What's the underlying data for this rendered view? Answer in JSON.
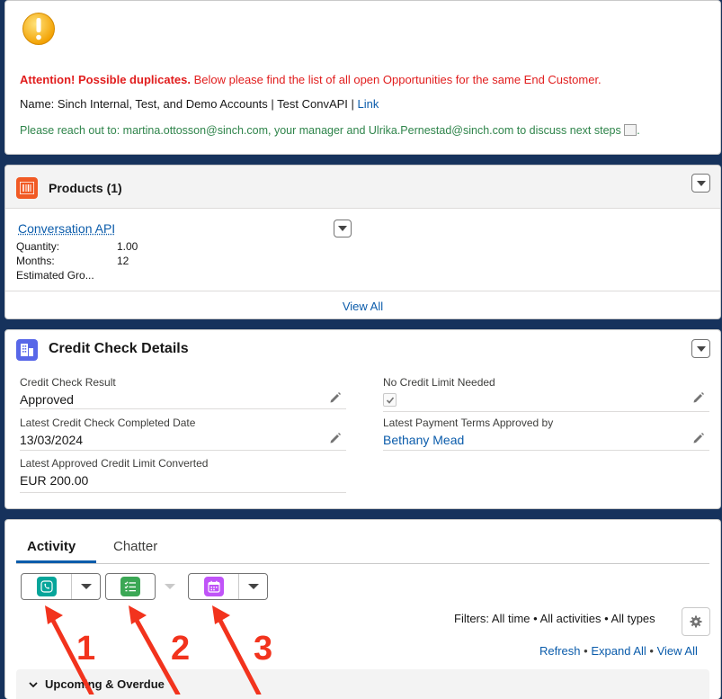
{
  "alert": {
    "attention": "Attention! Possible duplicates.",
    "message": " Below please find the list of all open Opportunities for the same End Customer.",
    "name_text": "Name: Sinch Internal, Test, and Demo Accounts | Test ConvAPI | ",
    "link_label": "Link",
    "reach_out": "Please reach out to: martina.ottosson@sinch.com, your manager and Ulrika.Pernestad@sinch.com to discuss next steps",
    "trailing": "."
  },
  "products": {
    "title": "Products (1)",
    "item_name": "Conversation API",
    "fields": [
      {
        "label": "Quantity:",
        "value": "1.00"
      },
      {
        "label": "Months:",
        "value": "12"
      },
      {
        "label": "Estimated Gro...",
        "value": ""
      }
    ],
    "view_all": "View All"
  },
  "credit": {
    "title": "Credit Check Details",
    "result_label": "Credit Check Result",
    "result_value": "Approved",
    "no_limit_label": "No Credit Limit Needed",
    "completed_label": "Latest Credit Check Completed Date",
    "completed_value": "13/03/2024",
    "terms_label": "Latest Payment Terms Approved by",
    "terms_value": "Bethany Mead",
    "limit_label": "Latest Approved Credit Limit Converted",
    "limit_value": "EUR 200.00"
  },
  "activity": {
    "tab_activity": "Activity",
    "tab_chatter": "Chatter",
    "filters": "Filters: All time • All activities • All types",
    "refresh": "Refresh",
    "expand_all": "Expand All",
    "view_all": "View All",
    "section": "Upcoming & Overdue",
    "annotations": [
      "1",
      "2",
      "3"
    ]
  },
  "colors": {
    "attention_red": "#e11d1d",
    "reach_out_green": "#2e844a",
    "link_blue": "#0b5cab",
    "annotation_red": "#f2331d"
  }
}
